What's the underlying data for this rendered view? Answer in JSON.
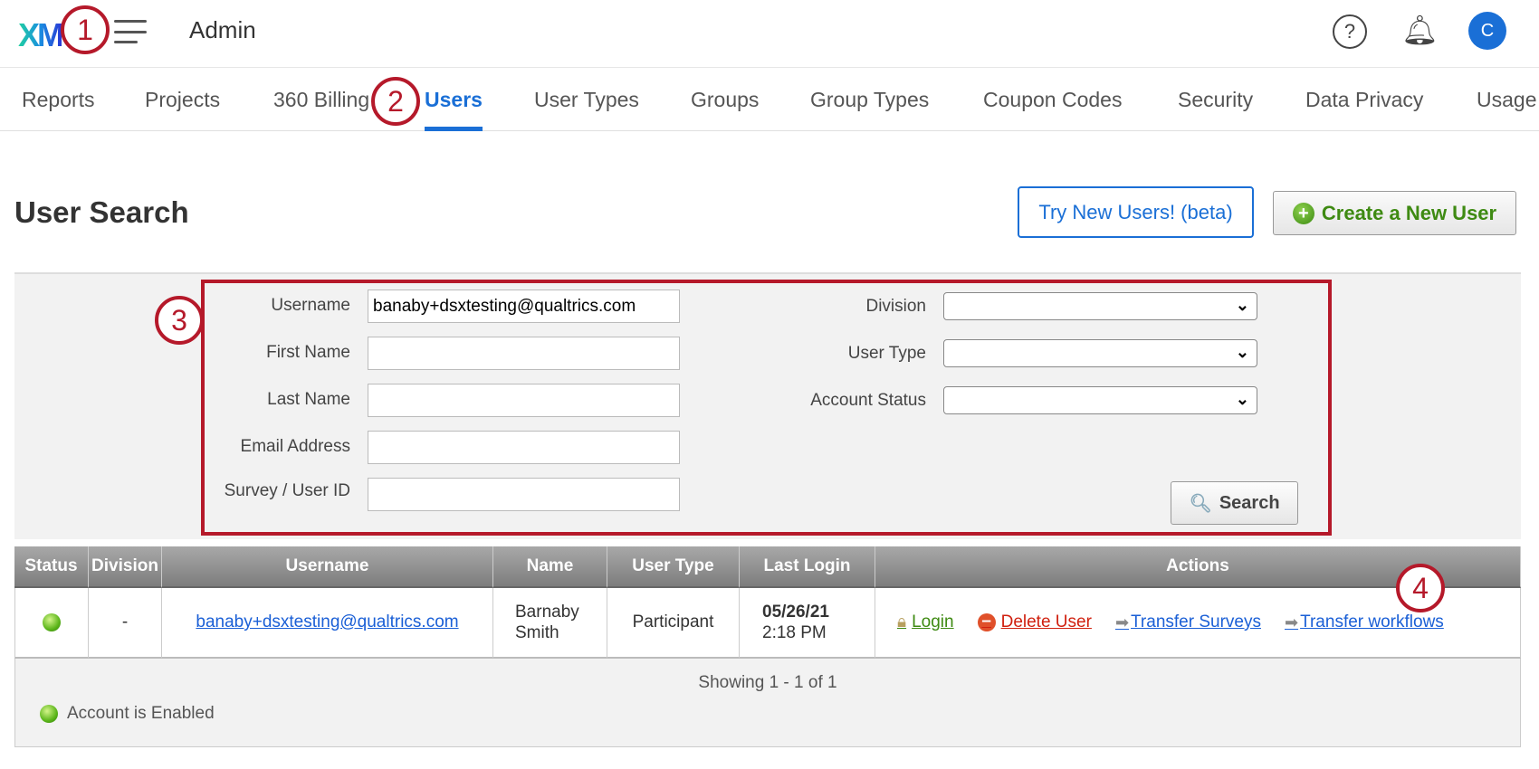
{
  "header": {
    "logo": "XM",
    "title": "Admin",
    "avatar_initial": "C",
    "icons": [
      "menu-icon",
      "help-icon",
      "bell-icon"
    ]
  },
  "nav": {
    "tabs": [
      {
        "label": "Reports"
      },
      {
        "label": "Projects"
      },
      {
        "label": "360 Billing"
      },
      {
        "label": "Users",
        "active": true
      },
      {
        "label": "User Types"
      },
      {
        "label": "Groups"
      },
      {
        "label": "Group Types"
      },
      {
        "label": "Coupon Codes"
      },
      {
        "label": "Security"
      },
      {
        "label": "Data Privacy"
      },
      {
        "label": "Usage"
      }
    ]
  },
  "page": {
    "title": "User Search",
    "try_new_label": "Try New Users! (beta)",
    "create_label": "Create a New User"
  },
  "search": {
    "username_label": "Username",
    "username_value": "banaby+dsxtesting@qualtrics.com",
    "first_name_label": "First Name",
    "first_name_value": "",
    "last_name_label": "Last Name",
    "last_name_value": "",
    "email_label": "Email Address",
    "email_value": "",
    "survey_id_label": "Survey / User ID",
    "survey_id_value": "",
    "division_label": "Division",
    "division_value": "",
    "user_type_label": "User Type",
    "user_type_value": "",
    "account_status_label": "Account Status",
    "account_status_value": "",
    "search_label": "Search"
  },
  "annotations": [
    "1",
    "2",
    "3",
    "4"
  ],
  "table": {
    "headers": [
      "Status",
      "Division",
      "Username",
      "Name",
      "User Type",
      "Last Login",
      "Actions"
    ],
    "rows": [
      {
        "status": "enabled",
        "division": "-",
        "username": "banaby+dsxtesting@qualtrics.com",
        "name_first": "Barnaby",
        "name_last": "Smith",
        "user_type": "Participant",
        "last_login_date": "05/26/21",
        "last_login_time": "2:18 PM",
        "actions": {
          "login": "Login",
          "delete": "Delete User",
          "transfer_surveys": "Transfer Surveys",
          "transfer_workflows": "Transfer workflows"
        }
      }
    ],
    "showing": "Showing 1 - 1 of 1",
    "legend": "Account is Enabled"
  },
  "colors": {
    "accent": "#1a6fd6",
    "annotation": "#b5192a",
    "login": "#3e8a12",
    "delete": "#d0200f",
    "link": "#1a5fd6"
  }
}
